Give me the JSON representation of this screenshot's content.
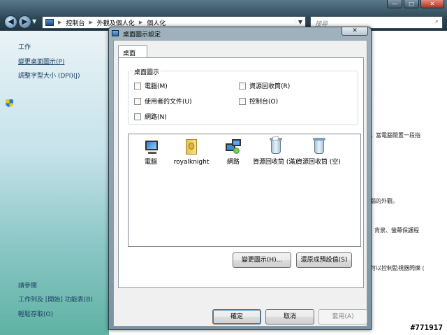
{
  "explorer": {
    "breadcrumb": [
      "控制台",
      "外觀及個人化",
      "個人化"
    ],
    "search_placeholder": "搜尋",
    "window_controls": [
      "—",
      "□",
      "✕"
    ]
  },
  "left_pane": {
    "tasks_heading": "工作",
    "task_links": [
      "變更桌面圖示(P)",
      "調整字型大小 (DPI)(J)"
    ],
    "see_also_heading": "請參閱",
    "see_also_links": [
      "工作列及 [開始] 功能表(B)",
      "輕鬆存取(O)"
    ]
  },
  "right_pane_fragments": [
    "，當電腦閒置一段指",
    "腦的外觀。",
    "背景、螢幕保護程",
    "可以控制監視器閃爍 ("
  ],
  "watermark": "#771917",
  "dialog": {
    "title": "桌面圖示設定",
    "close_glyph": "✕",
    "tab_label": "桌面",
    "group_title": "桌面圖示",
    "checkboxes": [
      {
        "label": "電腦(M)",
        "checked": false
      },
      {
        "label": "資源回收筒(R)",
        "checked": false
      },
      {
        "label": "使用者的文件(U)",
        "checked": false
      },
      {
        "label": "控制台(O)",
        "checked": false
      },
      {
        "label": "網路(N)",
        "checked": false
      }
    ],
    "icons": [
      {
        "icon": "computer-icon",
        "label": "電腦"
      },
      {
        "icon": "user-folder-icon",
        "label": "royalknight"
      },
      {
        "icon": "network-icon",
        "label": "網路"
      },
      {
        "icon": "recycle-bin-full-icon",
        "label": "資源回收筒 (滿)"
      },
      {
        "icon": "recycle-bin-empty-icon",
        "label": "資源回收筒 (空)"
      }
    ],
    "change_icon_button": "變更圖示(H)...",
    "restore_default_button": "還原成預設值(S)",
    "ok_button": "確定",
    "cancel_button": "取消",
    "apply_button": "套用(A)"
  }
}
